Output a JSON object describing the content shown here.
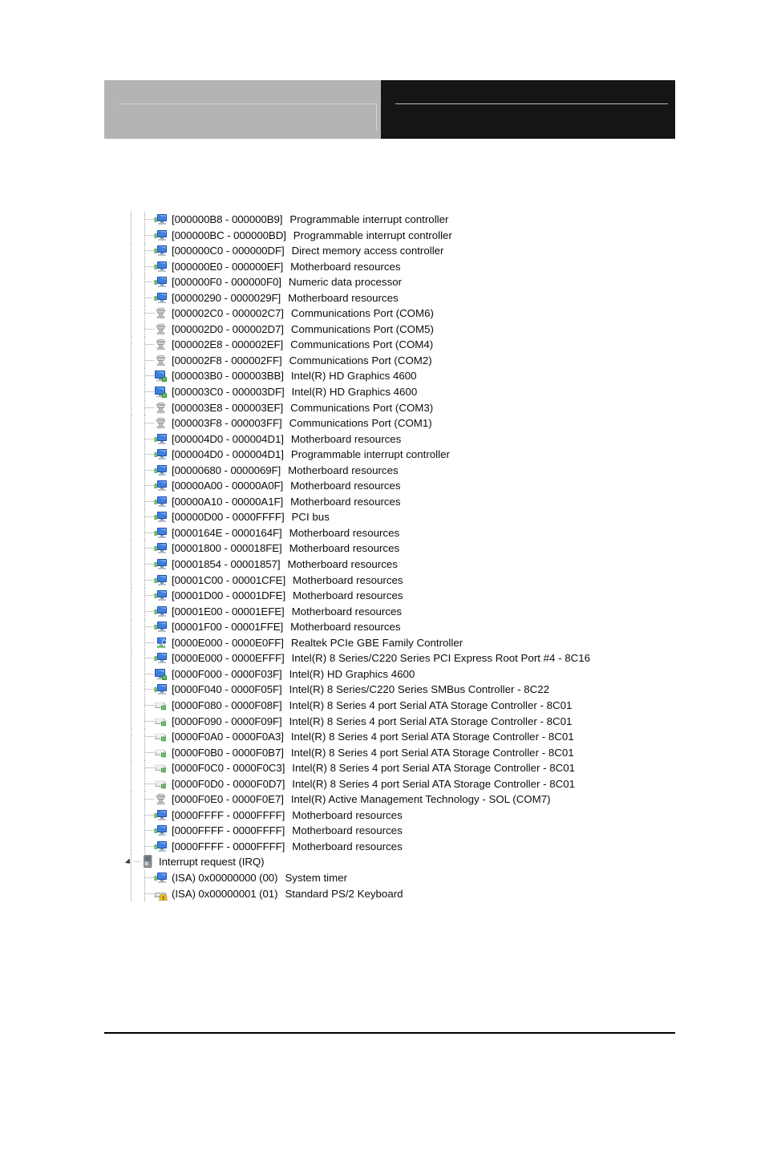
{
  "page": {
    "header": {
      "left_block_color": "#b4b4b4",
      "right_block_color": "#151515"
    },
    "footer": {
      "rule_color": "#000000"
    }
  },
  "tree": {
    "rows": [
      {
        "icon": "motherboard-resource-icon",
        "address": "[000000B8 - 000000B9]",
        "description": "Programmable interrupt controller"
      },
      {
        "icon": "motherboard-resource-icon",
        "address": "[000000BC - 000000BD]",
        "description": "Programmable interrupt controller"
      },
      {
        "icon": "motherboard-resource-icon",
        "address": "[000000C0 - 000000DF]",
        "description": "Direct memory access controller"
      },
      {
        "icon": "motherboard-resource-icon",
        "address": "[000000E0 - 000000EF]",
        "description": "Motherboard resources"
      },
      {
        "icon": "motherboard-resource-icon",
        "address": "[000000F0 - 000000F0]",
        "description": "Numeric data processor"
      },
      {
        "icon": "motherboard-resource-icon",
        "address": "[00000290 - 0000029F]",
        "description": "Motherboard resources"
      },
      {
        "icon": "serial-port-icon",
        "address": "[000002C0 - 000002C7]",
        "description": "Communications Port (COM6)"
      },
      {
        "icon": "serial-port-icon",
        "address": "[000002D0 - 000002D7]",
        "description": "Communications Port (COM5)"
      },
      {
        "icon": "serial-port-icon",
        "address": "[000002E8 - 000002EF]",
        "description": "Communications Port (COM4)"
      },
      {
        "icon": "serial-port-icon",
        "address": "[000002F8 - 000002FF]",
        "description": "Communications Port (COM2)"
      },
      {
        "icon": "display-adapter-icon",
        "address": "[000003B0 - 000003BB]",
        "description": "Intel(R) HD Graphics 4600"
      },
      {
        "icon": "display-adapter-icon",
        "address": "[000003C0 - 000003DF]",
        "description": "Intel(R) HD Graphics 4600"
      },
      {
        "icon": "serial-port-icon",
        "address": "[000003E8 - 000003EF]",
        "description": "Communications Port (COM3)"
      },
      {
        "icon": "serial-port-icon",
        "address": "[000003F8 - 000003FF]",
        "description": "Communications Port (COM1)"
      },
      {
        "icon": "motherboard-resource-icon",
        "address": "[000004D0 - 000004D1]",
        "description": "Motherboard resources"
      },
      {
        "icon": "motherboard-resource-icon",
        "address": "[000004D0 - 000004D1]",
        "description": "Programmable interrupt controller"
      },
      {
        "icon": "motherboard-resource-icon",
        "address": "[00000680 - 0000069F]",
        "description": "Motherboard resources"
      },
      {
        "icon": "motherboard-resource-icon",
        "address": "[00000A00 - 00000A0F]",
        "description": "Motherboard resources"
      },
      {
        "icon": "motherboard-resource-icon",
        "address": "[00000A10 - 00000A1F]",
        "description": "Motherboard resources"
      },
      {
        "icon": "motherboard-resource-icon",
        "address": "[00000D00 - 0000FFFF]",
        "description": "PCI bus"
      },
      {
        "icon": "motherboard-resource-icon",
        "address": "[0000164E - 0000164F]",
        "description": "Motherboard resources"
      },
      {
        "icon": "motherboard-resource-icon",
        "address": "[00001800 - 000018FE]",
        "description": "Motherboard resources"
      },
      {
        "icon": "motherboard-resource-icon",
        "address": "[00001854 - 00001857]",
        "description": "Motherboard resources"
      },
      {
        "icon": "motherboard-resource-icon",
        "address": "[00001C00 - 00001CFE]",
        "description": "Motherboard resources"
      },
      {
        "icon": "motherboard-resource-icon",
        "address": "[00001D00 - 00001DFE]",
        "description": "Motherboard resources"
      },
      {
        "icon": "motherboard-resource-icon",
        "address": "[00001E00 - 00001EFE]",
        "description": "Motherboard resources"
      },
      {
        "icon": "motherboard-resource-icon",
        "address": "[00001F00 - 00001FFE]",
        "description": "Motherboard resources"
      },
      {
        "icon": "network-adapter-icon",
        "address": "[0000E000 - 0000E0FF]",
        "description": "Realtek PCIe GBE Family Controller"
      },
      {
        "icon": "motherboard-resource-icon",
        "address": "[0000E000 - 0000EFFF]",
        "description": "Intel(R) 8 Series/C220 Series PCI Express Root Port #4 - 8C16"
      },
      {
        "icon": "display-adapter-icon",
        "address": "[0000F000 - 0000F03F]",
        "description": "Intel(R) HD Graphics 4600"
      },
      {
        "icon": "motherboard-resource-icon",
        "address": "[0000F040 - 0000F05F]",
        "description": "Intel(R) 8 Series/C220 Series SMBus Controller - 8C22"
      },
      {
        "icon": "storage-controller-icon",
        "address": "[0000F080 - 0000F08F]",
        "description": "Intel(R) 8 Series 4 port Serial ATA Storage Controller - 8C01"
      },
      {
        "icon": "storage-controller-icon",
        "address": "[0000F090 - 0000F09F]",
        "description": "Intel(R) 8 Series 4 port Serial ATA Storage Controller - 8C01"
      },
      {
        "icon": "storage-controller-icon",
        "address": "[0000F0A0 - 0000F0A3]",
        "description": "Intel(R) 8 Series 4 port Serial ATA Storage Controller - 8C01"
      },
      {
        "icon": "storage-controller-icon",
        "address": "[0000F0B0 - 0000F0B7]",
        "description": "Intel(R) 8 Series 4 port Serial ATA Storage Controller - 8C01"
      },
      {
        "icon": "storage-controller-icon",
        "address": "[0000F0C0 - 0000F0C3]",
        "description": "Intel(R) 8 Series 4 port Serial ATA Storage Controller - 8C01"
      },
      {
        "icon": "storage-controller-icon",
        "address": "[0000F0D0 - 0000F0D7]",
        "description": "Intel(R) 8 Series 4 port Serial ATA Storage Controller - 8C01"
      },
      {
        "icon": "serial-port-icon",
        "address": "[0000F0E0 - 0000F0E7]",
        "description": "Intel(R) Active Management Technology - SOL (COM7)"
      },
      {
        "icon": "motherboard-resource-icon",
        "address": "[0000FFFF - 0000FFFF]",
        "description": "Motherboard resources"
      },
      {
        "icon": "motherboard-resource-icon",
        "address": "[0000FFFF - 0000FFFF]",
        "description": "Motherboard resources"
      },
      {
        "icon": "motherboard-resource-icon",
        "address": "[0000FFFF - 0000FFFF]",
        "description": "Motherboard resources"
      },
      {
        "icon": "computer-tower-icon",
        "address": "Interrupt request (IRQ)",
        "description": "",
        "node": true,
        "expanded": true
      },
      {
        "icon": "motherboard-resource-icon",
        "address": "(ISA) 0x00000000 (00)",
        "description": "System timer"
      },
      {
        "icon": "keyboard-warning-icon",
        "address": "(ISA) 0x00000001 (01)",
        "description": "Standard PS/2 Keyboard"
      }
    ]
  }
}
